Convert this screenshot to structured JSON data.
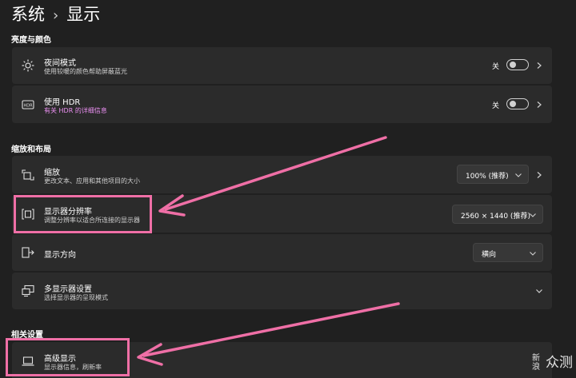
{
  "breadcrumb": {
    "parent": "系统",
    "separator": "›",
    "current": "显示"
  },
  "sections": {
    "brightness": "亮度与颜色",
    "scale_layout": "缩放和布局",
    "related": "相关设置"
  },
  "night_light": {
    "title": "夜间模式",
    "subtitle": "使用较暖的颜色帮助屏蔽蓝光",
    "toggle_label": "关"
  },
  "hdr": {
    "title": "使用 HDR",
    "subtitle": "有关 HDR 的详细信息",
    "toggle_label": "关"
  },
  "scale": {
    "title": "缩放",
    "subtitle": "更改文本、应用和其他项目的大小",
    "value": "100% (推荐)"
  },
  "resolution": {
    "title": "显示器分辨率",
    "subtitle": "调整分辨率以适合所连接的显示器",
    "value": "2560 × 1440 (推荐)"
  },
  "orientation": {
    "title": "显示方向",
    "value": "横向"
  },
  "multi_display": {
    "title": "多显示器设置",
    "subtitle": "选择显示器的呈现模式"
  },
  "advanced": {
    "title": "高级显示",
    "subtitle": "显示器信息，刷新率"
  },
  "watermark": {
    "line1": "新",
    "line2": "浪",
    "brand": "众测"
  },
  "colors": {
    "highlight": "#ef6fa6",
    "link": "#ea8ff0",
    "background": "#202020",
    "card": "#2b2b2b"
  }
}
